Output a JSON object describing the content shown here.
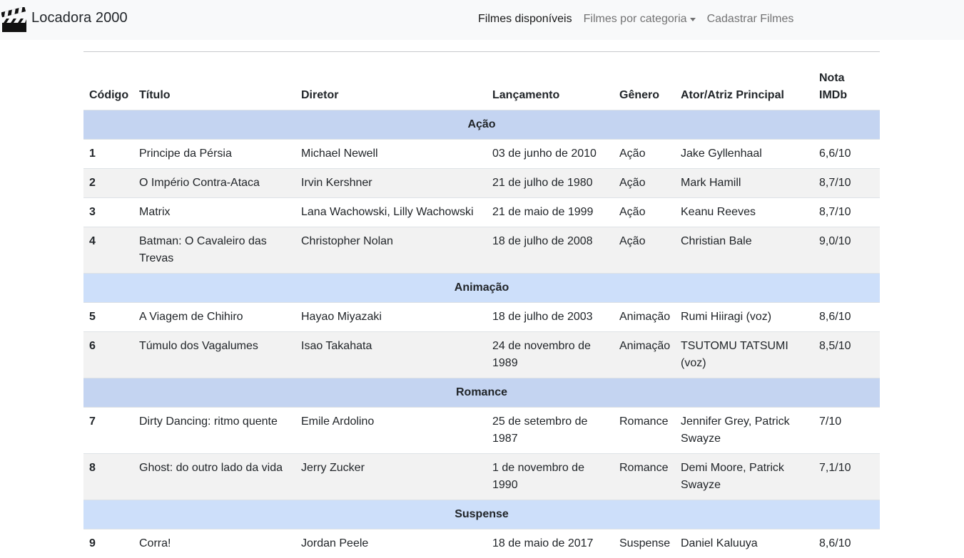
{
  "navbar": {
    "brand": "Locadora 2000",
    "links": [
      {
        "label": "Filmes disponíveis",
        "active": true
      },
      {
        "label": "Filmes por categoria",
        "dropdown": true
      },
      {
        "label": "Cadastrar Filmes"
      }
    ]
  },
  "table": {
    "headers": [
      "Código",
      "Título",
      "Diretor",
      "Lançamento",
      "Gênero",
      "Ator/Atriz Principal",
      "Nota IMDb"
    ],
    "categories": [
      {
        "name": "Ação",
        "rows": [
          [
            "1",
            "Principe da Pérsia",
            "Michael Newell",
            "03 de junho de 2010",
            "Ação",
            "Jake Gyllenhaal",
            "6,6/10"
          ],
          [
            "2",
            "O Império Contra-Ataca",
            "Irvin Kershner",
            "21 de julho de 1980",
            "Ação",
            "Mark Hamill",
            "8,7/10"
          ],
          [
            "3",
            "Matrix",
            "Lana Wachowski, Lilly Wachowski",
            "21 de maio de 1999",
            "Ação",
            "Keanu Reeves",
            "8,7/10"
          ],
          [
            "4",
            "Batman: O Cavaleiro das Trevas",
            "Christopher Nolan",
            "18 de julho de 2008",
            "Ação",
            "Christian Bale",
            "9,0/10"
          ]
        ]
      },
      {
        "name": "Animação",
        "rows": [
          [
            "5",
            "A Viagem de Chihiro",
            "Hayao Miyazaki",
            "18 de julho de 2003",
            "Animação",
            "Rumi Hiiragi (voz)",
            "8,6/10"
          ],
          [
            "6",
            "Túmulo dos Vagalumes",
            "Isao Takahata",
            "24 de novembro de 1989",
            "Animação",
            "TSUTOMU TATSUMI (voz)",
            "8,5/10"
          ]
        ]
      },
      {
        "name": "Romance",
        "rows": [
          [
            "7",
            "Dirty Dancing: ritmo quente",
            "Emile Ardolino",
            "25 de setembro de 1987",
            "Romance",
            "Jennifer Grey, Patrick Swayze",
            "7/10"
          ],
          [
            "8",
            "Ghost: do outro lado da vida",
            "Jerry Zucker",
            "1 de novembro de 1990",
            "Romance",
            "Demi Moore, Patrick Swayze",
            "7,1/10"
          ]
        ]
      },
      {
        "name": "Suspense",
        "rows": [
          [
            "9",
            "Corra!",
            "Jordan Peele",
            "18 de maio de 2017",
            "Suspense",
            "Daniel Kaluuya",
            "8,6/10"
          ]
        ]
      }
    ]
  },
  "colors": {
    "navbar_bg": "#f8f9fa",
    "category_row_a": "#c4d4f1",
    "category_row_b": "#cddffa",
    "striped_row": "#f2f2f2"
  }
}
